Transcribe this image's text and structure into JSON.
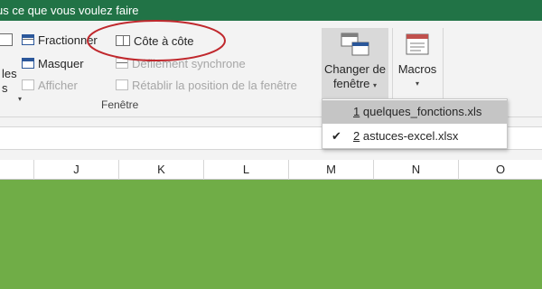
{
  "titlebar": {
    "text": "us ce que vous voulez faire"
  },
  "ribbon": {
    "left_partial": {
      "line1": "les",
      "line2": "s"
    },
    "fractionner": "Fractionner",
    "masquer": "Masquer",
    "afficher": "Afficher",
    "cote_a_cote": "Côte à côte",
    "defilement": "Défilement synchrone",
    "retablir": "Rétablir la position de la fenêtre",
    "group_label": "Fenêtre",
    "changer_line1": "Changer de",
    "changer_line2": "fenêtre",
    "macros": "Macros"
  },
  "columns": [
    "J",
    "K",
    "L",
    "M",
    "N",
    "O"
  ],
  "dropdown": {
    "items": [
      {
        "num": "1",
        "name": "quelques_fonctions.xls",
        "checked": false,
        "hover": true
      },
      {
        "num": "2",
        "name": "astuces-excel.xlsx",
        "checked": true,
        "hover": false
      }
    ],
    "check_glyph": "✔"
  },
  "colors": {
    "title_bar": "#217346",
    "sheet_fill": "#70ad47",
    "annotation": "#c0282d"
  }
}
